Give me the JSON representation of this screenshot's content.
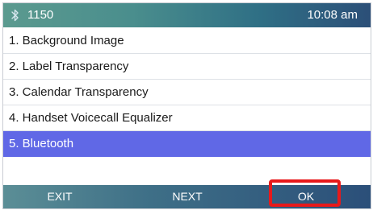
{
  "status": {
    "extension": "1150",
    "time": "10:08 am",
    "bluetooth_icon": "bluetooth-icon"
  },
  "menu": {
    "items": [
      {
        "label": "1. Background Image",
        "selected": false
      },
      {
        "label": "2. Label Transparency",
        "selected": false
      },
      {
        "label": "3. Calendar Transparency",
        "selected": false
      },
      {
        "label": "4. Handset Voicecall Equalizer",
        "selected": false
      },
      {
        "label": "5. Bluetooth",
        "selected": true
      }
    ]
  },
  "softkeys": {
    "exit": "EXIT",
    "next": "NEXT",
    "ok": "OK"
  },
  "colors": {
    "selection": "#6068e6",
    "highlight_box": "#e8191b"
  }
}
